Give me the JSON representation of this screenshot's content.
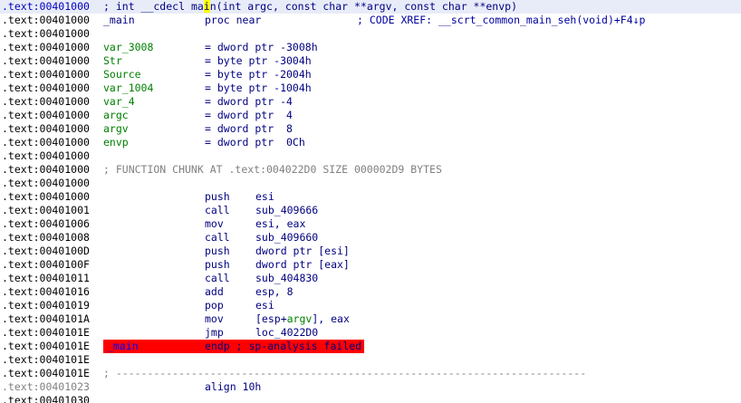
{
  "header": {
    "address": ".text:00401000",
    "prefix": "; int __cdecl ",
    "func_pre": "ma",
    "func_cursor": "i",
    "func_post": "n",
    "signature_rest": "(int argc, const char **argv, const char **envp)"
  },
  "proc": {
    "address": ".text:00401000",
    "label": "_main",
    "mnemonic": "proc near",
    "xref_comment": "; CODE XREF: __scrt_common_main_seh(void)+F4↓p"
  },
  "vars": [
    {
      "address": ".text:00401000",
      "name": "var_3008",
      "def": "= dword ptr -3008h"
    },
    {
      "address": ".text:00401000",
      "name": "Str",
      "def": "= byte ptr -3004h"
    },
    {
      "address": ".text:00401000",
      "name": "Source",
      "def": "= byte ptr -2004h"
    },
    {
      "address": ".text:00401000",
      "name": "var_1004",
      "def": "= byte ptr -1004h"
    },
    {
      "address": ".text:00401000",
      "name": "var_4",
      "def": "= dword ptr -4"
    },
    {
      "address": ".text:00401000",
      "name": "argc",
      "def": "= dword ptr  4"
    },
    {
      "address": ".text:00401000",
      "name": "argv",
      "def": "= dword ptr  8"
    },
    {
      "address": ".text:00401000",
      "name": "envp",
      "def": "= dword ptr  0Ch"
    }
  ],
  "chunk_comment": {
    "address": ".text:00401000",
    "text": "; FUNCTION CHUNK AT .text:004022D0 SIZE 000002D9 BYTES"
  },
  "blank_address": ".text:00401000",
  "instructions": [
    {
      "address": ".text:00401000",
      "mnemonic": "push",
      "operand": "esi"
    },
    {
      "address": ".text:00401001",
      "mnemonic": "call",
      "operand": "sub_409666"
    },
    {
      "address": ".text:00401006",
      "mnemonic": "mov",
      "operand": "esi, eax"
    },
    {
      "address": ".text:00401008",
      "mnemonic": "call",
      "operand": "sub_409660"
    },
    {
      "address": ".text:0040100D",
      "mnemonic": "push",
      "operand": "dword ptr [esi]"
    },
    {
      "address": ".text:0040100F",
      "mnemonic": "push",
      "operand": "dword ptr [eax]"
    },
    {
      "address": ".text:00401011",
      "mnemonic": "call",
      "operand": "sub_404830"
    },
    {
      "address": ".text:00401016",
      "mnemonic": "add",
      "operand": "esp, 8"
    },
    {
      "address": ".text:00401019",
      "mnemonic": "pop",
      "operand": "esi"
    },
    {
      "address": ".text:0040101A",
      "mnemonic": "mov",
      "operand_pre": "[esp+",
      "operand_var": "argv",
      "operand_post": "], eax"
    },
    {
      "address": ".text:0040101E",
      "mnemonic": "jmp",
      "operand": "loc_4022D0"
    }
  ],
  "endp": {
    "address": ".text:0040101E",
    "label": "_main",
    "text": "endp ; sp-analysis failed",
    "error_color": "#ff0000"
  },
  "tail": {
    "blank_address_1": ".text:0040101E",
    "separator_address": ".text:0040101E",
    "separator": "; ---------------------------------------------------------------------------",
    "align_address": ".text:00401023",
    "align_text": "align 10h",
    "last_address": ".text:00401030"
  },
  "colors": {
    "address": "#000000",
    "keyword": "#000080",
    "variable": "#008000",
    "comment": "#808080",
    "highlight": "#ffff00"
  }
}
